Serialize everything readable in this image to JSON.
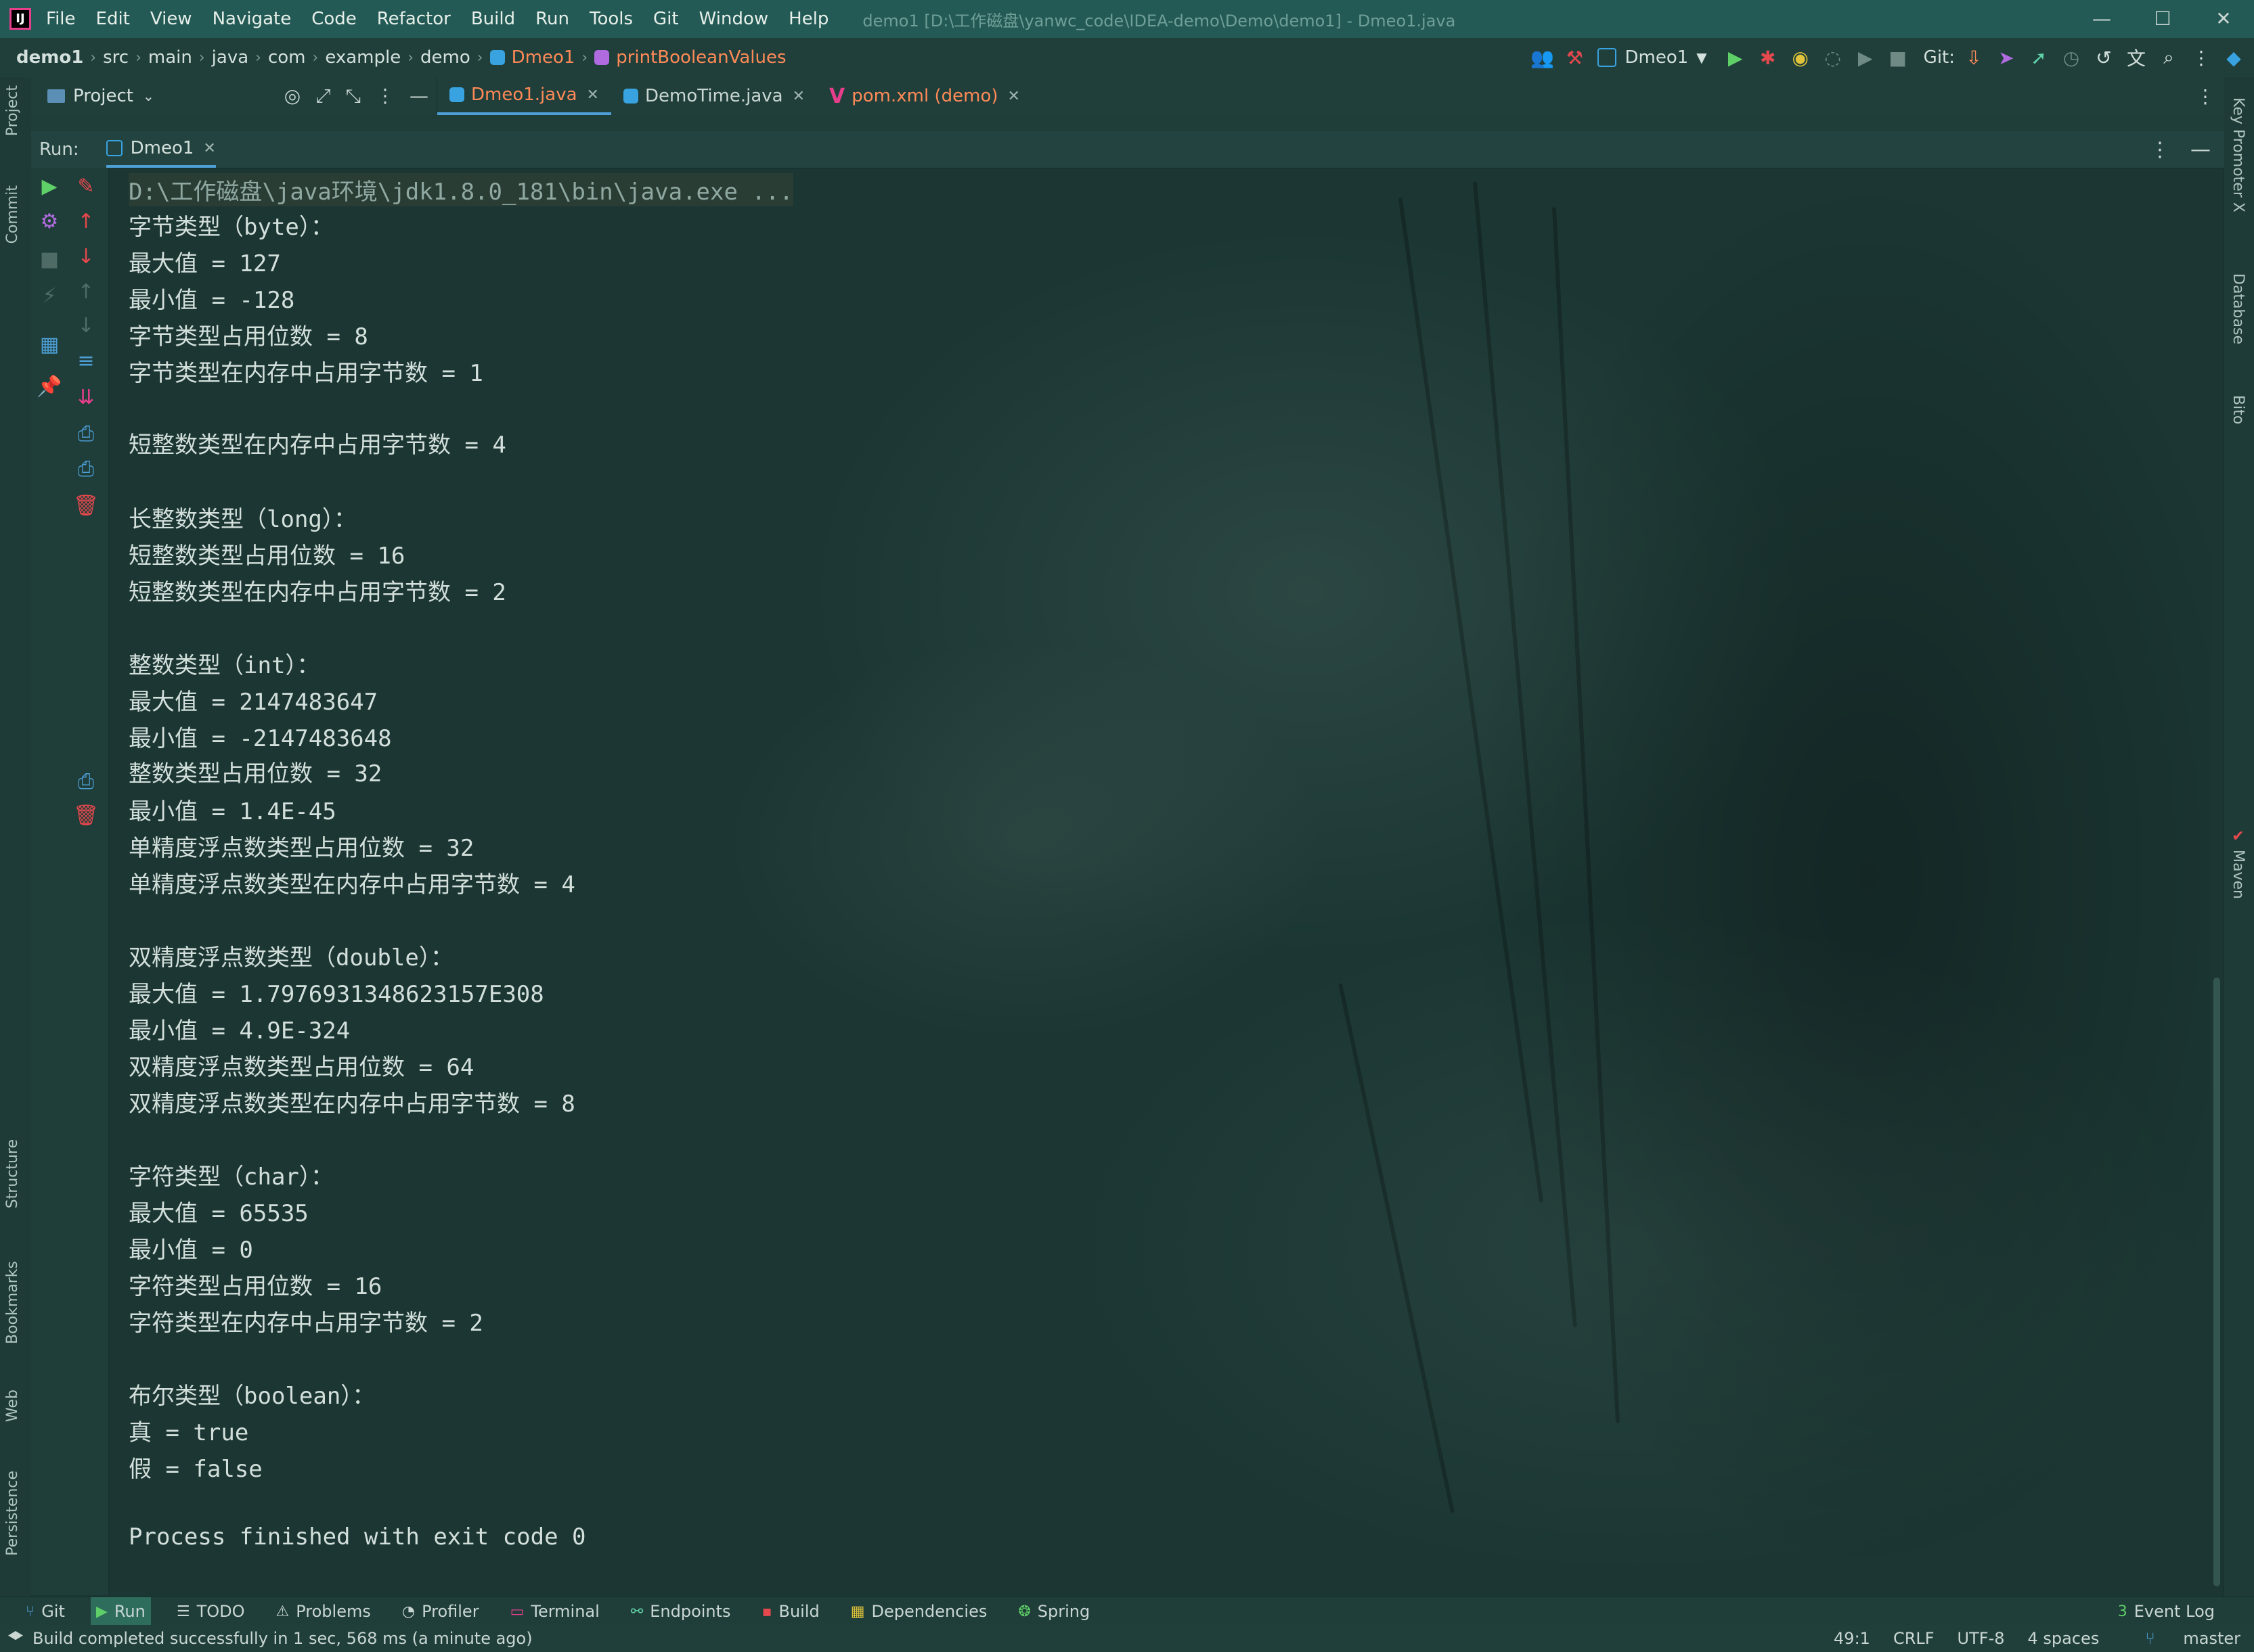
{
  "title_bar": {
    "menu": [
      "File",
      "Edit",
      "View",
      "Navigate",
      "Code",
      "Refactor",
      "Build",
      "Run",
      "Tools",
      "Git",
      "Window",
      "Help"
    ],
    "window_title": "demo1 [D:\\工作磁盘\\yanwc_code\\IDEA-demo\\Demo\\demo1] - Dmeo1.java",
    "controls": [
      "—",
      "☐",
      "✕"
    ]
  },
  "breadcrumb": {
    "items": [
      "demo1",
      "src",
      "main",
      "java",
      "com",
      "example",
      "demo",
      "Dmeo1",
      "printBooleanValues"
    ]
  },
  "toolbar": {
    "run_config": "Dmeo1",
    "git_label": "Git:"
  },
  "left_strip": [
    "Project",
    "Commit",
    "Structure",
    "Bookmarks",
    "Web",
    "Persistence"
  ],
  "right_strip": [
    "Key Promoter X",
    "Database",
    "Bito",
    "Maven"
  ],
  "project_header": "Project",
  "editor_tabs": [
    {
      "label": "Dmeo1.java",
      "active": true
    },
    {
      "label": "DemoTime.java",
      "active": false
    },
    {
      "label": "pom.xml (demo)",
      "active": false
    }
  ],
  "run_panel": {
    "label": "Run:",
    "tab": "Dmeo1"
  },
  "console": {
    "command": "D:\\工作磁盘\\java环境\\jdk1.8.0_181\\bin\\java.exe ...",
    "lines": [
      "字节类型（byte）：",
      "最大值 = 127",
      "最小值 = -128",
      "字节类型占用位数 = 8",
      "字节类型在内存中占用字节数 = 1",
      "短整数类型在内存中占用字节数 = 4",
      "",
      "长整数类型（long）：",
      "短整数类型占用位数 = 16",
      "短整数类型在内存中占用字节数 = 2",
      "",
      "整数类型（int）：",
      "最大值 = 2147483647",
      "最小值 = -2147483648",
      "整数类型占用位数 = 32",
      "最小值 = 1.4E-45",
      "单精度浮点数类型占用位数 = 32",
      "单精度浮点数类型在内存中占用字节数 = 4",
      "",
      "双精度浮点数类型（double）：",
      "最大值 = 1.7976931348623157E308",
      "最小值 = 4.9E-324",
      "双精度浮点数类型占用位数 = 64",
      "双精度浮点数类型在内存中占用字节数 = 8",
      "",
      "字符类型（char）：",
      "最大值 = 65535",
      "最小值 = 0",
      "字符类型占用位数 = 16",
      "字符类型在内存中占用字节数 = 2",
      "",
      "布尔类型（boolean）：",
      "真 = true",
      "假 = false",
      "",
      "Process finished with exit code 0"
    ]
  },
  "bottom_tools": [
    {
      "label": "Git",
      "icon": "git-icon"
    },
    {
      "label": "Run",
      "icon": "run-icon",
      "active": true
    },
    {
      "label": "TODO",
      "icon": "todo-icon"
    },
    {
      "label": "Problems",
      "icon": "problems-icon"
    },
    {
      "label": "Profiler",
      "icon": "profiler-icon"
    },
    {
      "label": "Terminal",
      "icon": "terminal-icon"
    },
    {
      "label": "Endpoints",
      "icon": "endpoints-icon"
    },
    {
      "label": "Build",
      "icon": "build-icon"
    },
    {
      "label": "Dependencies",
      "icon": "dependencies-icon"
    },
    {
      "label": "Spring",
      "icon": "spring-icon"
    }
  ],
  "event_log": {
    "count": "3",
    "label": "Event Log"
  },
  "status_bar": {
    "message": "Build completed successfully in 1 sec, 568 ms (a minute ago)",
    "position": "49:1",
    "line_sep": "CRLF",
    "encoding": "UTF-8",
    "indent": "4 spaces",
    "branch": "master"
  },
  "colors": {
    "title_bar": "#245a55",
    "background": "#1b3633",
    "accent_orange": "#ff8a57",
    "accent_blue": "#4d9fd6"
  }
}
